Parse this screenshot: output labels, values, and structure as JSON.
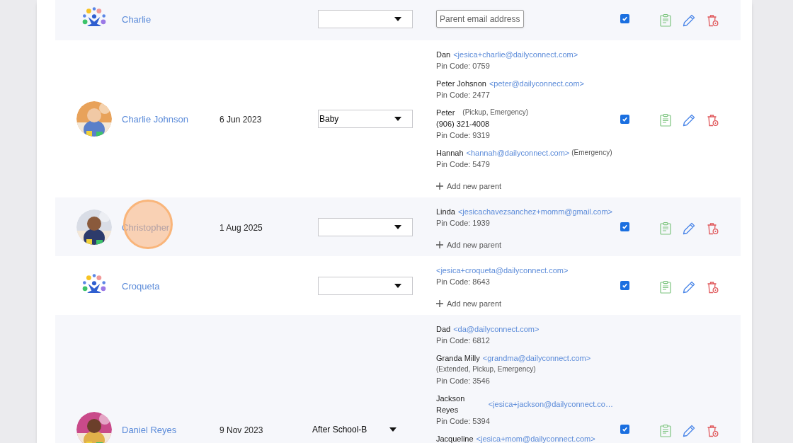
{
  "children": [
    {
      "name": "Charlie",
      "kind": "logo",
      "highlighted": false,
      "group": {
        "kind": "boxed"
      },
      "email_field": {
        "placeholder": "Parent email address"
      },
      "checked": true
    },
    {
      "name": "Charlie Johnson",
      "highlighted": false,
      "birth_date": "6 Jun 2023",
      "group": {
        "kind": "boxed",
        "value": "Baby"
      },
      "parents": [
        {
          "name": "Dan",
          "email": "<jesica+charlie@dailyconnect.com>",
          "pin": "Pin Code: 0759"
        },
        {
          "name": "Peter Johsnon",
          "email": "<peter@dailyconnect.com>",
          "pin": "Pin Code: 2477"
        },
        {
          "name": "Peter",
          "roles": "(Pickup, Emergency)",
          "phone": "(906) 321-4008",
          "pin": "Pin Code: 9319"
        },
        {
          "name": "Hannah",
          "email": "<hannah@dailyconnect.com>",
          "roles": "(Emergency)",
          "pin": "Pin Code: 5479"
        }
      ],
      "add_parent": "Add new parent",
      "checked": true
    },
    {
      "name": "Christopher",
      "highlighted": true,
      "birth_date": "1 Aug 2025",
      "group": {
        "kind": "boxed"
      },
      "parents": [
        {
          "name": "Linda",
          "email": "<jesicachavezsanchez+momm@gmail.com>",
          "pin": "Pin Code: 1939"
        }
      ],
      "add_parent": "Add new parent",
      "checked": true
    },
    {
      "name": "Croqueta",
      "kind": "logo",
      "highlighted": false,
      "group": {
        "kind": "boxed"
      },
      "parents": [
        {
          "email": "<jesica+croqueta@dailyconnect.com>",
          "pin": "Pin Code: 8643"
        }
      ],
      "add_parent": "Add new parent",
      "checked": true
    },
    {
      "name": "Daniel Reyes",
      "highlighted": false,
      "birth_date": "9 Nov 2023",
      "group": {
        "kind": "plain",
        "value": "After School-B"
      },
      "parents": [
        {
          "name": "Dad",
          "email": "<da@dailyconnect.com>",
          "pin": "Pin Code: 6812"
        },
        {
          "name": "Granda Milly",
          "email": "<grandma@dailyconnect.com>",
          "roles": "(Extended, Pickup, Emergency)",
          "pin": "Pin Code: 3546"
        },
        {
          "name": "Jackson Reyes",
          "email": "<jesica+jackson@dailyconnect.co…",
          "pin": "Pin Code: 5394"
        },
        {
          "name": "Jacqueline",
          "email": "<jesica+mom@dailyconnect.com>"
        }
      ],
      "checked": true
    }
  ]
}
